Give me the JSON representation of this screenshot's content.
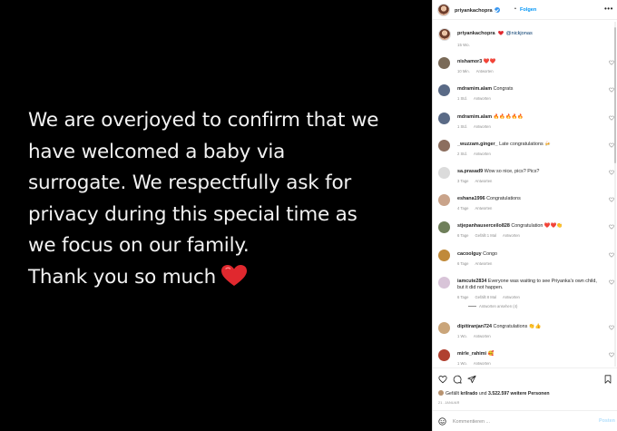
{
  "media": {
    "lines": [
      "We are overjoyed to confirm that we",
      "have welcomed a baby via",
      "surrogate. We respectfully ask for",
      "privacy during this special time as",
      "we focus on our family.",
      "Thank you so much"
    ],
    "emoji": "heart-emoji"
  },
  "header": {
    "username": "priyankachopra",
    "separator": "•",
    "follow": "Folgen",
    "more": "•••"
  },
  "caption": {
    "username": "priyankachopra",
    "mention": "@nickjonas",
    "time": "15 Wo."
  },
  "comments": [
    {
      "user": "nishamor3",
      "text": "❤️❤️",
      "meta": [
        "10 Min.",
        "Antworten"
      ],
      "avatar_color": "#7a6a58"
    },
    {
      "user": "mdramim.alam",
      "text": "Congrats",
      "meta": [
        "1 Std.",
        "Antworten"
      ],
      "avatar_color": "#5a6a86"
    },
    {
      "user": "mdramim.alam",
      "text": "🔥🔥🔥🔥🔥",
      "meta": [
        "1 Std.",
        "Antworten"
      ],
      "avatar_color": "#5a6a86"
    },
    {
      "user": "_wuzzam.ginger_",
      "text": "Late congratulations 🍻",
      "meta": [
        "2 Std.",
        "Antworten"
      ],
      "avatar_color": "#8c6e5e"
    },
    {
      "user": "sa.prasad9",
      "text": "Wow so nice, pics? Pics?",
      "meta": [
        "3 Tage",
        "Antworten"
      ],
      "avatar_color": "#dbdbdb"
    },
    {
      "user": "eshana1996",
      "text": "Congratulations",
      "meta": [
        "4 Tage",
        "Antworten"
      ],
      "avatar_color": "#c9a38a"
    },
    {
      "user": "stjepanhauserceilo828",
      "text": "Congratulation ❤️❤️👏",
      "meta": [
        "6 Tage",
        "Gefällt 1 Mal",
        "Antworten"
      ],
      "avatar_color": "#6f7f5a"
    },
    {
      "user": "cacoolguy",
      "text": "Congo",
      "meta": [
        "6 Tage",
        "Antworten"
      ],
      "avatar_color": "#c08a3a"
    },
    {
      "user": "iamcute2834",
      "text": "Everyone was waiting to see Priyanka's own child, but it did not happen.",
      "meta": [
        "6 Tage",
        "Gefällt 8 Mal",
        "Antworten"
      ],
      "avatar_color": "#d8c4d8",
      "replies": "Antworten ansehen (4)"
    },
    {
      "user": "dipitiranjan724",
      "text": "Congratulations 👏👍",
      "meta": [
        "1 Wo.",
        "Antworten"
      ],
      "avatar_color": "#caa57a"
    },
    {
      "user": "mirle_rahimi",
      "text": "🥰",
      "meta": [
        "1 Wo.",
        "Antworten"
      ],
      "avatar_color": "#b04030"
    }
  ],
  "likes": {
    "prefix": "Gefällt ",
    "user": "krilrado",
    "middle": " und ",
    "count": "3.522.597",
    "suffix": " weitere Personen"
  },
  "post_date": "21. JANUAR",
  "add_comment": {
    "placeholder": "Kommentieren ...",
    "post": "Posten"
  },
  "colors": {
    "accent": "#0095f6",
    "heart_red": "#ed4956",
    "text": "#262626",
    "muted": "#8e8e8e"
  }
}
